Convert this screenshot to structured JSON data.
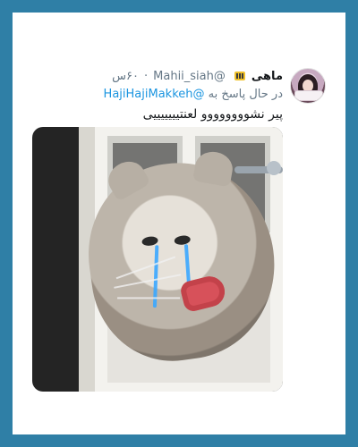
{
  "tweet": {
    "display_name": "ماهی",
    "handle": "@Mahii_siah",
    "time": "۶۰س",
    "reply_prefix": "در حال پاسخ به",
    "reply_to": "@HajiHajiMakkeh",
    "text": "پیر نشوووووووو لعنتیییییییی"
  },
  "colors": {
    "background": "#2f7fa6",
    "card": "#ffffff",
    "accent_link": "#1b95e0",
    "muted_text": "#657786",
    "primary_text": "#14171a"
  },
  "icons": {
    "badge": "emoji-badge-icon"
  }
}
